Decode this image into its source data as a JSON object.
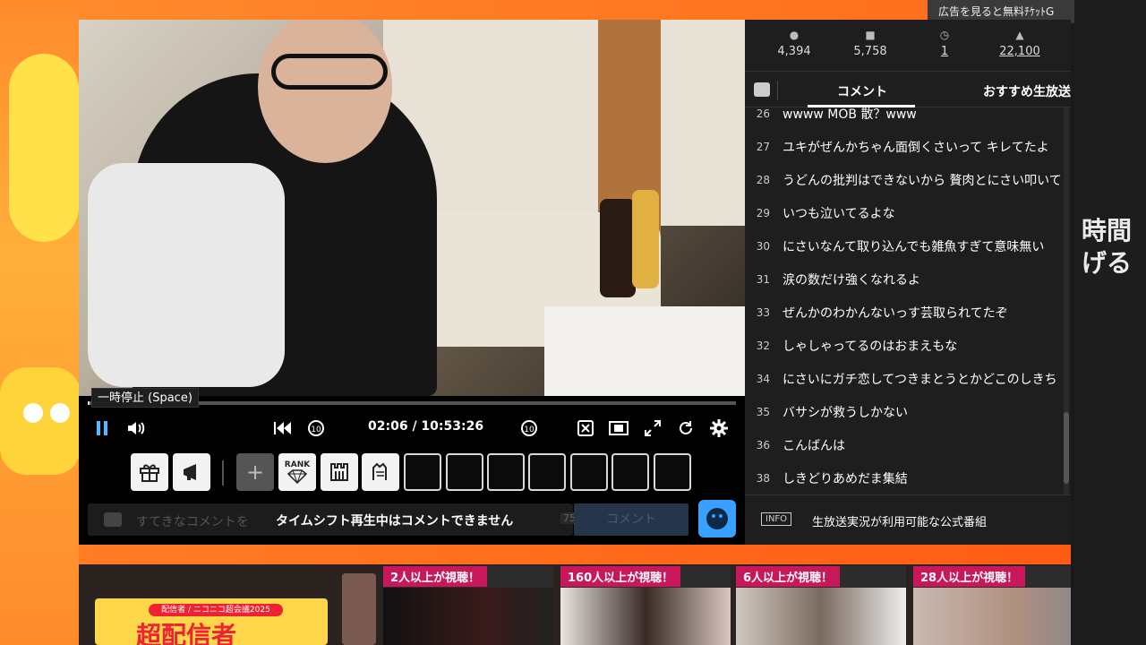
{
  "ad_banner": "広告を見ると無料ﾁｹｯﾄG",
  "side_text_line1": "時間",
  "side_text_line2": "げる",
  "player": {
    "tooltip": "一時停止 (Space)",
    "time": "02:06 / 10:53:26",
    "progress": 0.0032,
    "rank_label": "RANK",
    "comment_placeholder": "すてきなコメントを",
    "comment_notice": "タイムシフト再生中はコメントできません",
    "comment_count": "75",
    "comment_submit": "コメント"
  },
  "stats": {
    "viewers": "4,394",
    "comments": "5,758",
    "timeshift": "1",
    "ads": "22,100"
  },
  "tabs": {
    "comments": "コメント",
    "recommended": "おすすめ生放送"
  },
  "comments": [
    {
      "num": "26",
      "text": "wwww MOB 散？www"
    },
    {
      "num": "27",
      "text": "ユキがぜんかちゃん面倒くさいって キレてたよ"
    },
    {
      "num": "28",
      "text": "うどんの批判はできないから 贅肉とにさい叩いて"
    },
    {
      "num": "29",
      "text": "いつも泣いてるよな"
    },
    {
      "num": "30",
      "text": "にさいなんて取り込んでも雑魚すぎて意味無い"
    },
    {
      "num": "31",
      "text": "涙の数だけ強くなれるよ"
    },
    {
      "num": "33",
      "text": "ぜんかのわかんないっす芸取られてたぞ"
    },
    {
      "num": "32",
      "text": "しゃしゃってるのはおまえもな"
    },
    {
      "num": "34",
      "text": "にさいにガチ恋してつきまとうとかどこのしきち"
    },
    {
      "num": "35",
      "text": "バサシが救うしかない"
    },
    {
      "num": "36",
      "text": "こんばんは"
    },
    {
      "num": "38",
      "text": "しきどりあめだま集結"
    }
  ],
  "info": {
    "badge": "INFO",
    "text": "生放送実況が利用可能な公式番組"
  },
  "recommendations": [
    {
      "label": "2人以上が視聴！"
    },
    {
      "label": "160人以上が視聴！"
    },
    {
      "label": "6人以上が視聴！"
    },
    {
      "label": "28人以上が視聴！"
    }
  ],
  "promo": {
    "tag": "配信者 / ニコニコ超会議2025",
    "title": "超配信者"
  },
  "colors": {
    "accent_blue": "#3aa0ff",
    "label_pink": "#c8175a",
    "brand_orange": "#ff8a2c"
  }
}
